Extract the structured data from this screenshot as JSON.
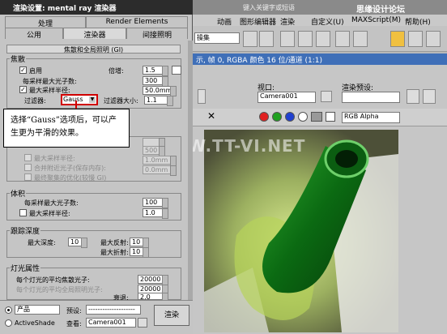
{
  "bg": {
    "title": "键入关键字或短语",
    "watermark": "思缘设计论坛 WWW.MISSYUAN.COM",
    "menu": [
      "动画",
      "图形编辑器",
      "渲染",
      "自定义(U)",
      "MAXScript(M)",
      "帮助(H)"
    ],
    "toolbar_combo": "操集",
    "render_frame_title": "示, 帧 0, RGBA 颜色 16 位/通道 (1:1)",
    "viewport_label": "视口:",
    "viewport_value": "Camera001",
    "preset_label": "渲染预设:",
    "preset_value": "",
    "channel_value": "RGB Alpha",
    "image_watermark": "WWW.TT-VI.NET",
    "colors": {
      "titlebar": "#3f6fb8",
      "active_tool": "#f0c040"
    }
  },
  "dialog": {
    "title": "渲染设置: mental ray 渲染器",
    "tabs_row1": [
      "处理",
      "Render Elements"
    ],
    "tabs_row2": [
      "公用",
      "渲染器",
      "间接照明"
    ],
    "rollout_title": "焦散和全局照明 (GI)",
    "caustics": {
      "group": "焦散",
      "enable_label": "启用",
      "multiplier_label": "倍增:",
      "multiplier_value": "1.5",
      "max_photons_label": "每采样最大光子数:",
      "max_photons_value": "300",
      "max_radius_label": "最大采样半径:",
      "max_radius_value": "50.0mm",
      "filter_label": "过滤器:",
      "filter_value": "Gauss",
      "filter_size_label": "过滤器大小:",
      "filter_size_value": "1.1"
    },
    "gi_disabled": {
      "max_radius_label": "最大采样半径:",
      "max_radius_value": "500",
      "merge_label": "合并附近光子(保存内存):",
      "merge_value": "1.0mm",
      "final_gather_label": "最终聚集的优化(较慢 GI)",
      "final_gather_value": "0.0mm"
    },
    "volume": {
      "group": "体积",
      "max_photons_label": "每采样最大光子数:",
      "max_photons_value": "100",
      "max_radius_label": "最大采样半径:",
      "max_radius_value": "1.0"
    },
    "trace_depth": {
      "group": "跟踪深度",
      "max_depth_label": "最大深度:",
      "max_depth_value": "10",
      "max_reflect_label": "最大反射:",
      "max_reflect_value": "10",
      "max_refract_label": "最大折射:",
      "max_refract_value": "10"
    },
    "light_props": {
      "group": "灯光属性",
      "caustic_photons_label": "每个灯光的平均焦散光子:",
      "caustic_photons_value": "20000",
      "gi_photons_label": "每个灯光的平均全局照明光子:",
      "gi_photons_value": "20000",
      "decay_label": "衰退:",
      "decay_value": "2.0"
    },
    "bottom": {
      "product_label": "产品",
      "preset_label": "预设:",
      "preset_value": "--------------------",
      "activeshade_label": "ActiveShade",
      "view_label": "查看:",
      "view_value": "Camera001",
      "render_label": "渲染"
    }
  },
  "callout": {
    "text": "选择“Gauss”选项后，可以产生更为平滑的效果。"
  }
}
